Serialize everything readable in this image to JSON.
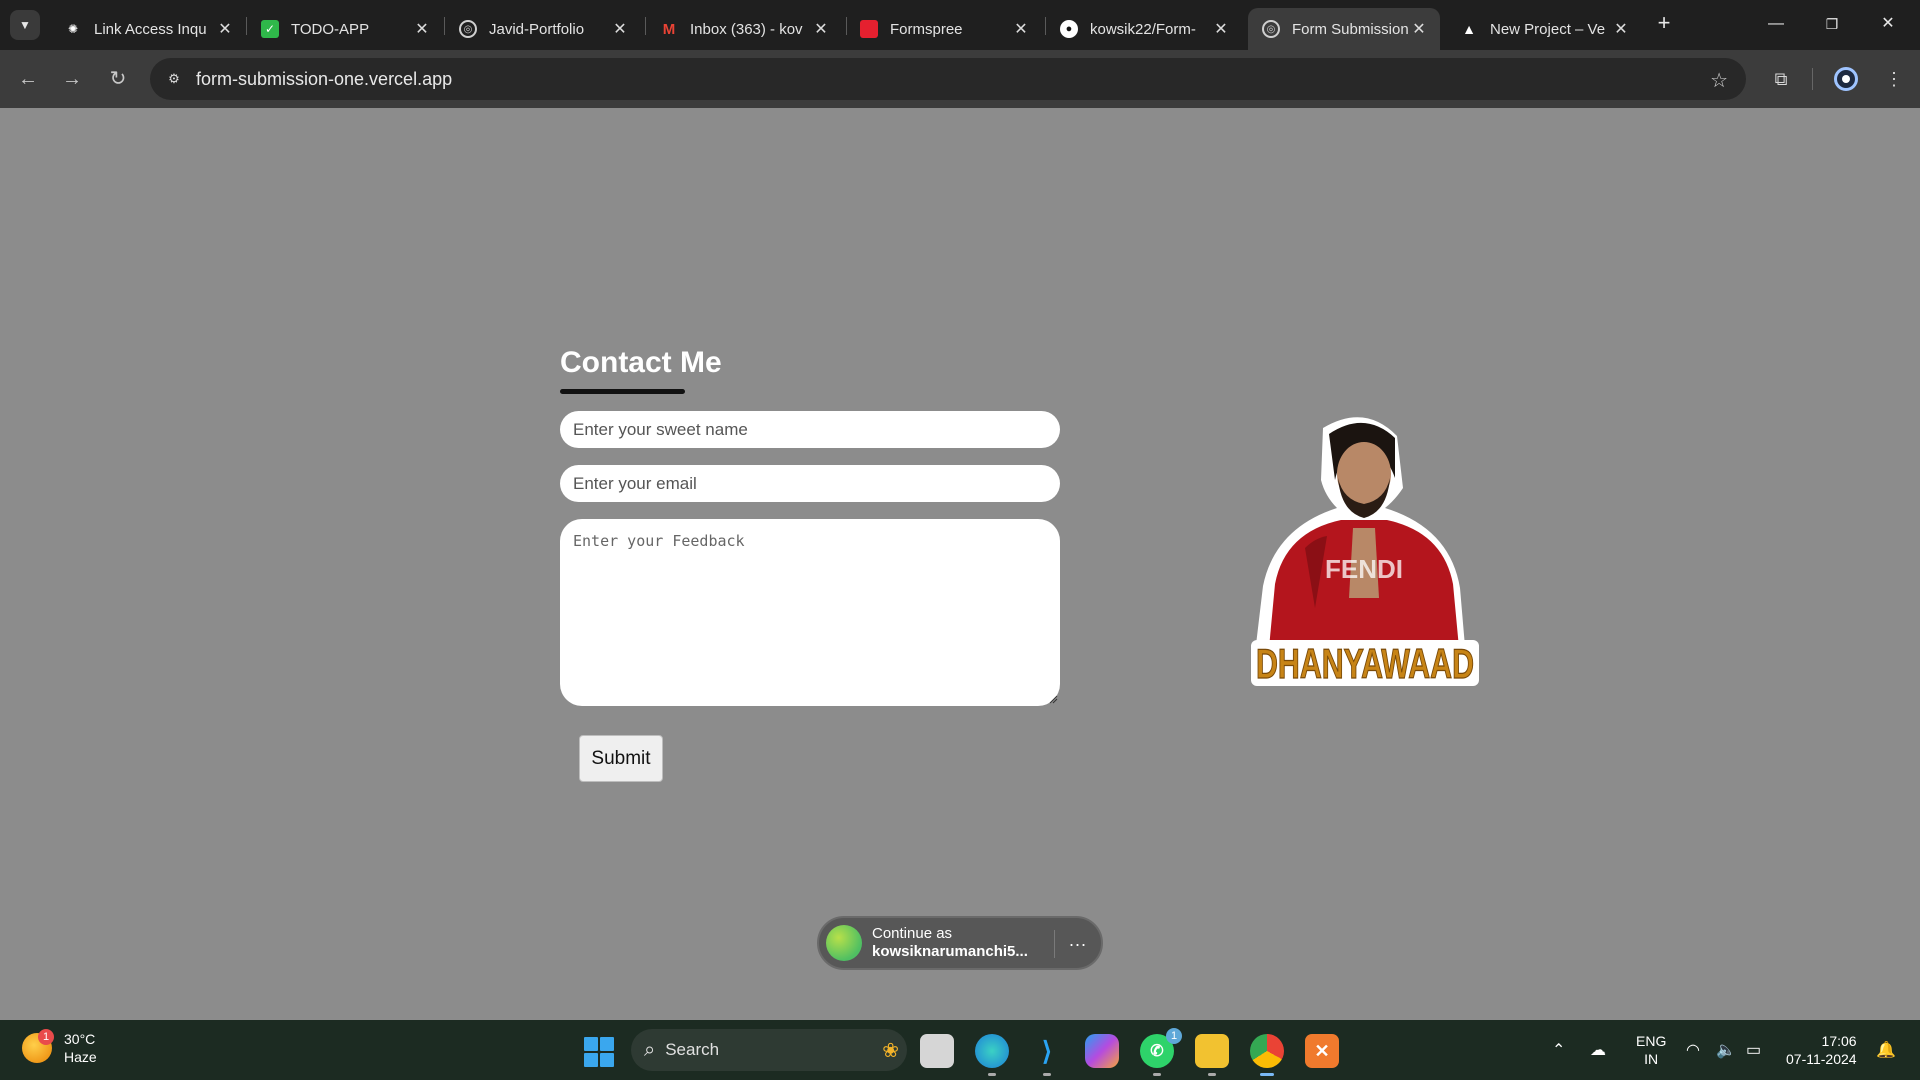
{
  "browser": {
    "tabs": [
      {
        "title": "Link Access Inqu",
        "icon": "openai-icon"
      },
      {
        "title": "TODO-APP",
        "icon": "checkbox-icon"
      },
      {
        "title": "Javid-Portfolio",
        "icon": "globe-icon"
      },
      {
        "title": "Inbox (363) - kov",
        "icon": "gmail-icon"
      },
      {
        "title": "Formspree",
        "icon": "formspree-icon"
      },
      {
        "title": "kowsik22/Form-",
        "icon": "github-icon"
      },
      {
        "title": "Form Submission",
        "icon": "globe-icon",
        "active": true
      },
      {
        "title": "New Project – Ve",
        "icon": "vercel-icon"
      }
    ],
    "url": "form-submission-one.vercel.app"
  },
  "form": {
    "title": "Contact Me",
    "name_placeholder": "Enter your sweet name",
    "email_placeholder": "Enter your email",
    "feedback_placeholder": "Enter your Feedback",
    "submit_label": "Submit"
  },
  "sticker": {
    "text": "DHANYAWAAD",
    "jacket_text": "FENDI"
  },
  "signin": {
    "line1": "Continue as",
    "line2": "kowsiknarumanchi5...",
    "more": "..."
  },
  "taskbar": {
    "weather_temp": "30°C",
    "weather_desc": "Haze",
    "weather_badge": "1",
    "search_label": "Search",
    "whatsapp_badge": "1",
    "lang_line1": "ENG",
    "lang_line2": "IN",
    "time": "17:06",
    "date": "07-11-2024"
  },
  "colors": {
    "page_bg": "#8c8c8c",
    "tab_bg": "#1f1f1f",
    "toolbar_bg": "#3c3c3c",
    "taskbar_bg": "#1c2b22"
  }
}
